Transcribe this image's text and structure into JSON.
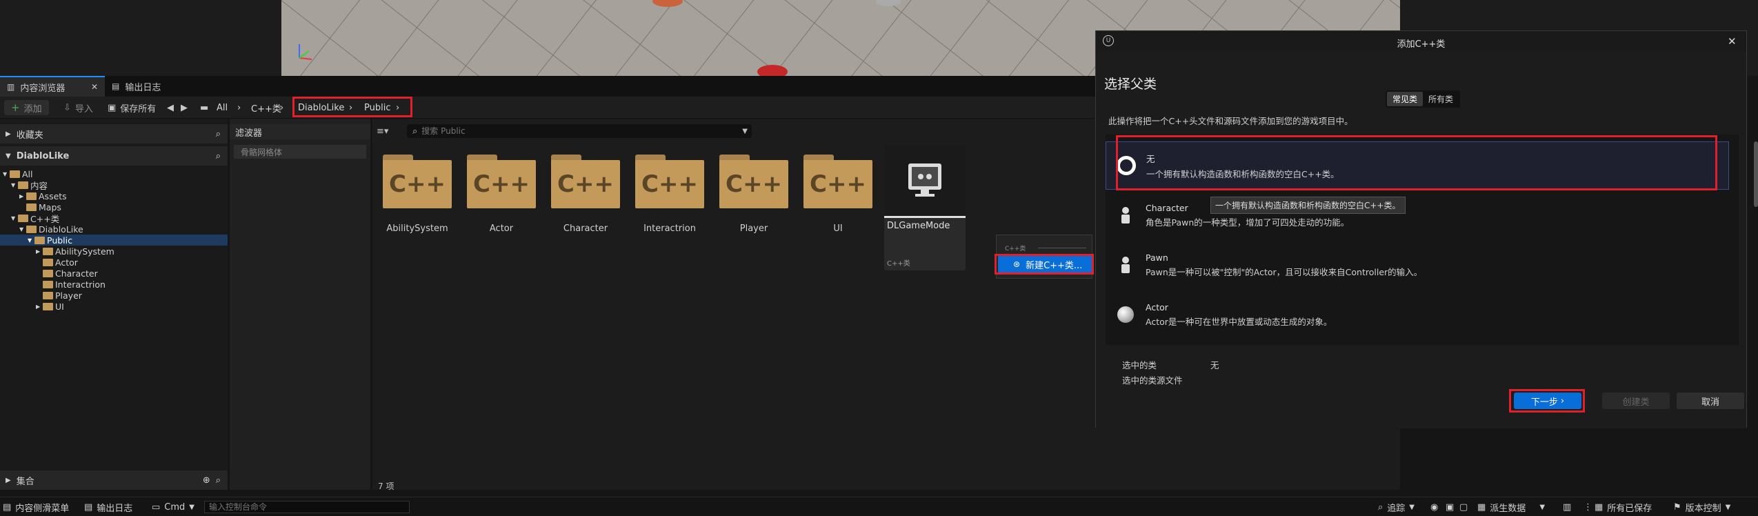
{
  "tabs": {
    "content_browser": "内容浏览器",
    "output_log": "输出日志"
  },
  "toolbar": {
    "add": "添加",
    "import": "导入",
    "save_all": "保存所有"
  },
  "breadcrumb": {
    "all": "All",
    "cpp": "C++类",
    "project": "DiabloLike",
    "public": "Public"
  },
  "left_panel": {
    "favorites": "收藏夹",
    "project": "DiabloLike",
    "tree": [
      {
        "label": "All",
        "level": 0,
        "expanded": true
      },
      {
        "label": "内容",
        "level": 1,
        "expanded": true
      },
      {
        "label": "Assets",
        "level": 2,
        "expanded": false
      },
      {
        "label": "Maps",
        "level": 2,
        "expanded": null
      },
      {
        "label": "C++类",
        "level": 1,
        "expanded": true
      },
      {
        "label": "DiabloLike",
        "level": 2,
        "expanded": true
      },
      {
        "label": "Public",
        "level": 3,
        "expanded": true,
        "selected": true
      },
      {
        "label": "AbilitySystem",
        "level": 4,
        "expanded": false
      },
      {
        "label": "Actor",
        "level": 4,
        "expanded": null
      },
      {
        "label": "Character",
        "level": 4,
        "expanded": null
      },
      {
        "label": "Interactrion",
        "level": 4,
        "expanded": null
      },
      {
        "label": "Player",
        "level": 4,
        "expanded": null
      },
      {
        "label": "UI",
        "level": 4,
        "expanded": false
      }
    ],
    "collections": "集合"
  },
  "filter_panel": {
    "title": "滤波器",
    "item": "骨骼网格体"
  },
  "content": {
    "search_placeholder": "搜索 Public",
    "folders": [
      "AbilitySystem",
      "Actor",
      "Character",
      "Interactrion",
      "Player",
      "UI"
    ],
    "folder_icon_text": "C++",
    "class_asset": {
      "name": "DLGameMode",
      "type": "C++类"
    },
    "item_count": "7 项"
  },
  "context_menu": {
    "header": "C++类",
    "new_class": "新建C++类..."
  },
  "dialog": {
    "title": "添加C++类",
    "heading": "选择父类",
    "filter_tabs": [
      "常见类",
      "所有类"
    ],
    "description": "此操作将把一个C++头文件和源码文件添加到您的游戏项目中。",
    "options": [
      {
        "title": "无",
        "desc": "一个拥有默认构造函数和析构函数的空白C++类。",
        "icon": "circle-icon"
      },
      {
        "title": "Character",
        "desc": "角色是Pawn的一种类型，增加了可四处走动的功能。",
        "icon": "character-icon"
      },
      {
        "title": "Pawn",
        "desc": "Pawn是一种可以被\"控制\"的Actor，且可以接收来自Controller的输入。",
        "icon": "pawn-icon"
      },
      {
        "title": "Actor",
        "desc": "Actor是一种可在世界中放置或动态生成的对象。",
        "icon": "sphere-icon"
      }
    ],
    "tooltip": "一个拥有默认构造函数和析构函数的空白C++类。",
    "selected_class_label": "选中的类",
    "selected_class_value": "无",
    "selected_source_label": "选中的类源文件",
    "buttons": {
      "next": "下一步",
      "create": "创建类",
      "cancel": "取消"
    },
    "accent_color": "#0a6ed8"
  },
  "status": {
    "drawer": "内容侧滑菜单",
    "output": "输出日志",
    "cmd": "Cmd",
    "console_placeholder": "输入控制台命令",
    "trace": "追踪",
    "derived": "派生数据",
    "saved": "所有已保存",
    "version_control": "版本控制"
  }
}
